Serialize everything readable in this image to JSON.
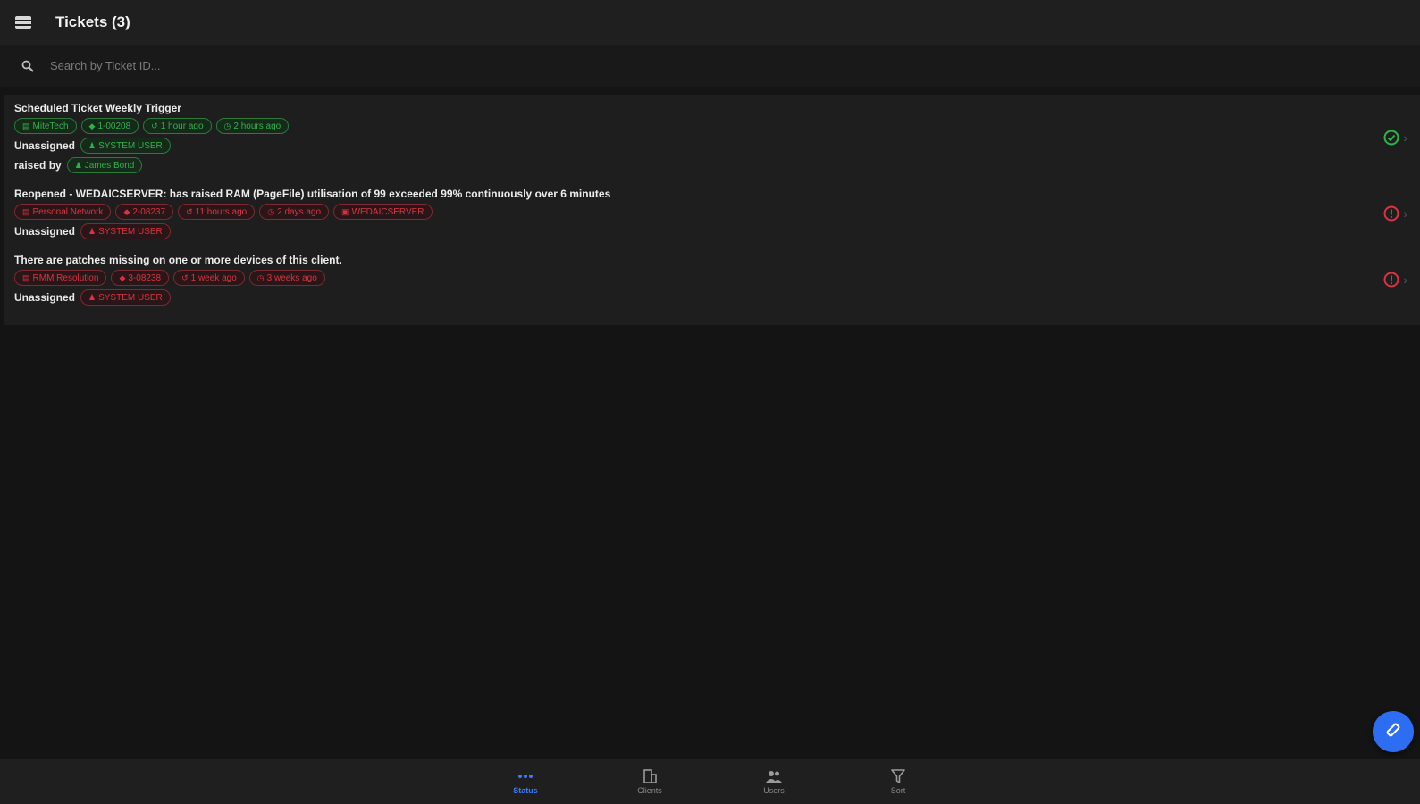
{
  "header": {
    "title": "Tickets (3)"
  },
  "search": {
    "placeholder": "Search by Ticket ID..."
  },
  "tickets": [
    {
      "title": "Scheduled Ticket Weekly Trigger",
      "status": "resolved",
      "color": "#2fb24c",
      "chips": [
        {
          "icon": "building-icon",
          "label": "MiteTech"
        },
        {
          "icon": "tag-icon",
          "label": "1-00208"
        },
        {
          "icon": "history-icon",
          "label": "1 hour ago"
        },
        {
          "icon": "clock-icon",
          "label": "2 hours ago"
        }
      ],
      "assigned_label": "Unassigned",
      "assigned_chip": "SYSTEM USER",
      "raised_label": "raised by",
      "raised_chip": "James Bond"
    },
    {
      "title": "Reopened - WEDAICSERVER: has raised RAM (PageFile) utilisation of 99 exceeded 99% continuously over 6 minutes",
      "status": "alert",
      "color": "#d8343f",
      "chips": [
        {
          "icon": "building-icon",
          "label": "Personal Network"
        },
        {
          "icon": "tag-icon",
          "label": "2-08237"
        },
        {
          "icon": "history-icon",
          "label": "11 hours ago"
        },
        {
          "icon": "clock-icon",
          "label": "2 days ago"
        },
        {
          "icon": "monitor-icon",
          "label": "WEDAICSERVER"
        }
      ],
      "assigned_label": "Unassigned",
      "assigned_chip": "SYSTEM USER"
    },
    {
      "title": "There are patches missing on one or more devices of this client.",
      "status": "alert",
      "color": "#d8343f",
      "chips": [
        {
          "icon": "building-icon",
          "label": "RMM Resolution"
        },
        {
          "icon": "tag-icon",
          "label": "3-08238"
        },
        {
          "icon": "history-icon",
          "label": "1 week ago"
        },
        {
          "icon": "clock-icon",
          "label": "3 weeks ago"
        }
      ],
      "assigned_label": "Unassigned",
      "assigned_chip": "SYSTEM USER"
    }
  ],
  "nav": {
    "items": [
      {
        "icon": "dots-icon",
        "label": "Status",
        "active": true
      },
      {
        "icon": "clients-icon",
        "label": "Clients",
        "active": false
      },
      {
        "icon": "users-icon",
        "label": "Users",
        "active": false
      },
      {
        "icon": "filter-icon",
        "label": "Sort",
        "active": false
      }
    ]
  },
  "colors": {
    "accent": "#2c6df2",
    "success": "#2fb24c",
    "danger": "#d8343f"
  }
}
